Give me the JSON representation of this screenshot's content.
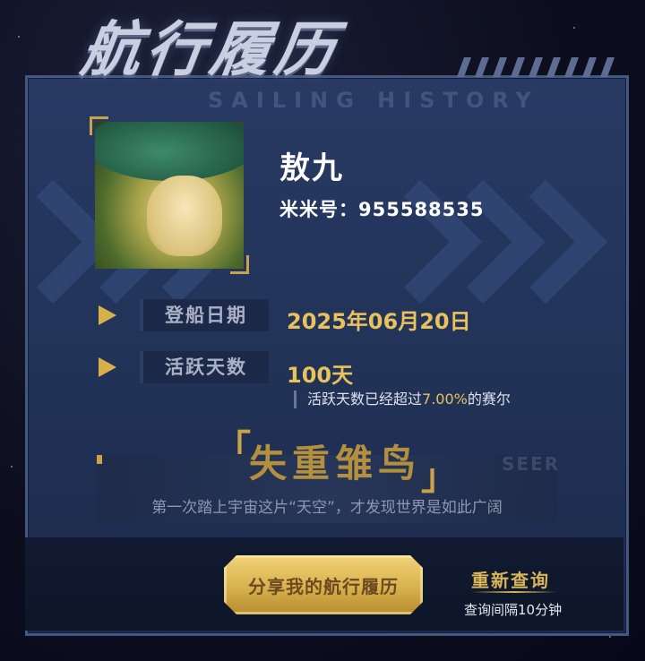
{
  "header": {
    "title": "航行履历",
    "subtitle": "SAILING HISTORY"
  },
  "profile": {
    "name": "敖九",
    "mimi_label": "米米号：",
    "mimi_id": "955588535"
  },
  "rows": [
    {
      "label": "登船日期",
      "value": "2025年06月20日"
    },
    {
      "label": "活跃天数",
      "value": "100天"
    }
  ],
  "active_note": {
    "prefix": "活跃天数已经超过",
    "percent": "7.00%",
    "suffix": "的赛尔"
  },
  "badge": {
    "title": "失重雏鸟",
    "watermark": "SEER",
    "description": "第一次踏上宇宙这片“天空”，才发现世界是如此广阔"
  },
  "actions": {
    "share_label": "分享我的航行履历",
    "requery_label": "重新查询",
    "interval_text": "查询间隔10分钟"
  },
  "colors": {
    "accent_gold": "#e9c15d",
    "panel": "#243660",
    "label_gray": "#aab1c6"
  }
}
